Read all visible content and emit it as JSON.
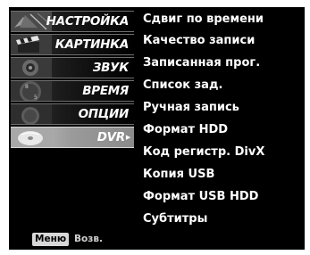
{
  "main_menu": {
    "items": [
      {
        "label": "НАСТРОЙКА",
        "selected": false
      },
      {
        "label": "КАРТИНКА",
        "selected": false
      },
      {
        "label": "ЗВУК",
        "selected": false
      },
      {
        "label": "ВРЕМЯ",
        "selected": false
      },
      {
        "label": "ОПЦИИ",
        "selected": false
      },
      {
        "label": "DVR",
        "selected": true
      }
    ],
    "selected_arrow": "▶"
  },
  "dvr_submenu": {
    "items": [
      "Сдвиг по времени",
      "Качество записи",
      "Записанная прог.",
      "Список зад.",
      "Ручная запись",
      "Формат HDD",
      "Код регистр. DivX",
      "Копия USB",
      "Формат USB HDD",
      "Субтитры"
    ]
  },
  "footer": {
    "menu_key": "Меню",
    "back_label": "Возв."
  },
  "colors": {
    "background": "#000000",
    "text": "#ffffff",
    "selected_item": "#a0a0a0"
  }
}
